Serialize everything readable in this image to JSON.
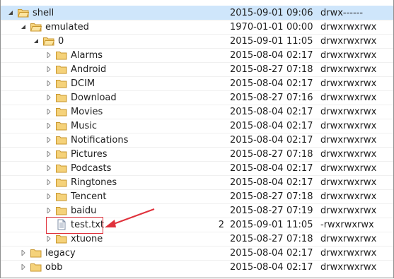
{
  "colors": {
    "folder_fill": "#f5d27a",
    "folder_edge": "#c8962c",
    "arrow": "#e0323c",
    "selected_row": "#cfe6fb"
  },
  "tree": [
    {
      "name": "shell",
      "date": "2015-09-01",
      "time": "09:06",
      "perm": "drwx------",
      "size": "",
      "depth": 0,
      "expanded": true,
      "type": "folder",
      "selected": true
    },
    {
      "name": "emulated",
      "date": "1970-01-01",
      "time": "00:00",
      "perm": "drwxrwxrwx",
      "size": "",
      "depth": 1,
      "expanded": true,
      "type": "folder"
    },
    {
      "name": "0",
      "date": "2015-09-01",
      "time": "11:05",
      "perm": "drwxrwxrwx",
      "size": "",
      "depth": 2,
      "expanded": true,
      "type": "folder"
    },
    {
      "name": "Alarms",
      "date": "2015-08-04",
      "time": "02:17",
      "perm": "drwxrwxrwx",
      "size": "",
      "depth": 3,
      "expanded": false,
      "type": "folder"
    },
    {
      "name": "Android",
      "date": "2015-08-27",
      "time": "07:18",
      "perm": "drwxrwxrwx",
      "size": "",
      "depth": 3,
      "expanded": false,
      "type": "folder"
    },
    {
      "name": "DCIM",
      "date": "2015-08-04",
      "time": "02:17",
      "perm": "drwxrwxrwx",
      "size": "",
      "depth": 3,
      "expanded": false,
      "type": "folder"
    },
    {
      "name": "Download",
      "date": "2015-08-27",
      "time": "07:16",
      "perm": "drwxrwxrwx",
      "size": "",
      "depth": 3,
      "expanded": false,
      "type": "folder"
    },
    {
      "name": "Movies",
      "date": "2015-08-04",
      "time": "02:17",
      "perm": "drwxrwxrwx",
      "size": "",
      "depth": 3,
      "expanded": false,
      "type": "folder"
    },
    {
      "name": "Music",
      "date": "2015-08-04",
      "time": "02:17",
      "perm": "drwxrwxrwx",
      "size": "",
      "depth": 3,
      "expanded": false,
      "type": "folder"
    },
    {
      "name": "Notifications",
      "date": "2015-08-04",
      "time": "02:17",
      "perm": "drwxrwxrwx",
      "size": "",
      "depth": 3,
      "expanded": false,
      "type": "folder"
    },
    {
      "name": "Pictures",
      "date": "2015-08-27",
      "time": "07:18",
      "perm": "drwxrwxrwx",
      "size": "",
      "depth": 3,
      "expanded": false,
      "type": "folder"
    },
    {
      "name": "Podcasts",
      "date": "2015-08-04",
      "time": "02:17",
      "perm": "drwxrwxrwx",
      "size": "",
      "depth": 3,
      "expanded": false,
      "type": "folder"
    },
    {
      "name": "Ringtones",
      "date": "2015-08-04",
      "time": "02:17",
      "perm": "drwxrwxrwx",
      "size": "",
      "depth": 3,
      "expanded": false,
      "type": "folder"
    },
    {
      "name": "Tencent",
      "date": "2015-08-27",
      "time": "07:18",
      "perm": "drwxrwxrwx",
      "size": "",
      "depth": 3,
      "expanded": false,
      "type": "folder"
    },
    {
      "name": "baidu",
      "date": "2015-08-27",
      "time": "07:19",
      "perm": "drwxrwxrwx",
      "size": "",
      "depth": 3,
      "expanded": false,
      "type": "folder"
    },
    {
      "name": "test.txt",
      "date": "2015-09-01",
      "time": "11:05",
      "perm": "-rwxrwxrwx",
      "size": "2",
      "depth": 3,
      "expanded": false,
      "type": "file"
    },
    {
      "name": "xtuone",
      "date": "2015-08-27",
      "time": "07:18",
      "perm": "drwxrwxrwx",
      "size": "",
      "depth": 3,
      "expanded": false,
      "type": "folder"
    },
    {
      "name": "legacy",
      "date": "2015-08-04",
      "time": "02:17",
      "perm": "drwxrwxrwx",
      "size": "",
      "depth": 1,
      "expanded": false,
      "type": "folder"
    },
    {
      "name": "obb",
      "date": "2015-08-04",
      "time": "02:17",
      "perm": "drwxrwxrwx",
      "size": "",
      "depth": 1,
      "expanded": false,
      "type": "folder"
    }
  ],
  "annotation": {
    "icon": "red-arrow-icon"
  }
}
